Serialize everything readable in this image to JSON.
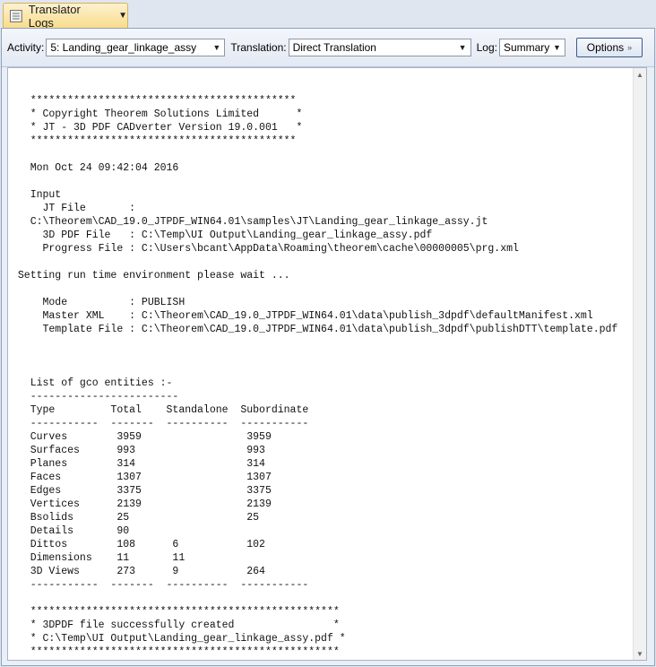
{
  "tab": {
    "title": "Translator Logs",
    "chevron": "▼"
  },
  "toolbar": {
    "activity_label": "Activity:",
    "activity_value": "5: Landing_gear_linkage_assy",
    "translation_label": "Translation:",
    "translation_value": "Direct Translation",
    "log_label": "Log:",
    "log_value": "Summary",
    "options_label": "Options",
    "options_chevron": "»"
  },
  "log_lines": [
    "",
    "   *******************************************",
    "   * Copyright Theorem Solutions Limited      *",
    "   * JT - 3D PDF CADverter Version 19.0.001   *",
    "   *******************************************",
    "",
    "   Mon Oct 24 09:42:04 2016",
    "",
    "   Input",
    "     JT File       :",
    "   C:\\Theorem\\CAD_19.0_JTPDF_WIN64.01\\samples\\JT\\Landing_gear_linkage_assy.jt",
    "     3D PDF File   : C:\\Temp\\UI Output\\Landing_gear_linkage_assy.pdf",
    "     Progress File : C:\\Users\\bcant\\AppData\\Roaming\\theorem\\cache\\00000005\\prg.xml",
    "",
    " Setting run time environment please wait ...",
    "",
    "     Mode          : PUBLISH",
    "     Master XML    : C:\\Theorem\\CAD_19.0_JTPDF_WIN64.01\\data\\publish_3dpdf\\defaultManifest.xml",
    "     Template File : C:\\Theorem\\CAD_19.0_JTPDF_WIN64.01\\data\\publish_3dpdf\\publishDTT\\template.pdf",
    "",
    "",
    "",
    "   List of gco entities :-",
    "   ------------------------",
    "   Type         Total    Standalone  Subordinate",
    "   -----------  -------  ----------  -----------",
    "   Curves        3959                 3959",
    "   Surfaces      993                  993",
    "   Planes        314                  314",
    "   Faces         1307                 1307",
    "   Edges         3375                 3375",
    "   Vertices      2139                 2139",
    "   Bsolids       25                   25",
    "   Details       90",
    "   Dittos        108      6           102",
    "   Dimensions    11       11",
    "   3D Views      273      9           264",
    "   -----------  -------  ----------  -----------",
    "",
    "   **************************************************",
    "   * 3DPDF file successfully created                *",
    "   * C:\\Temp\\UI Output\\Landing_gear_linkage_assy.pdf *",
    "   **************************************************"
  ]
}
